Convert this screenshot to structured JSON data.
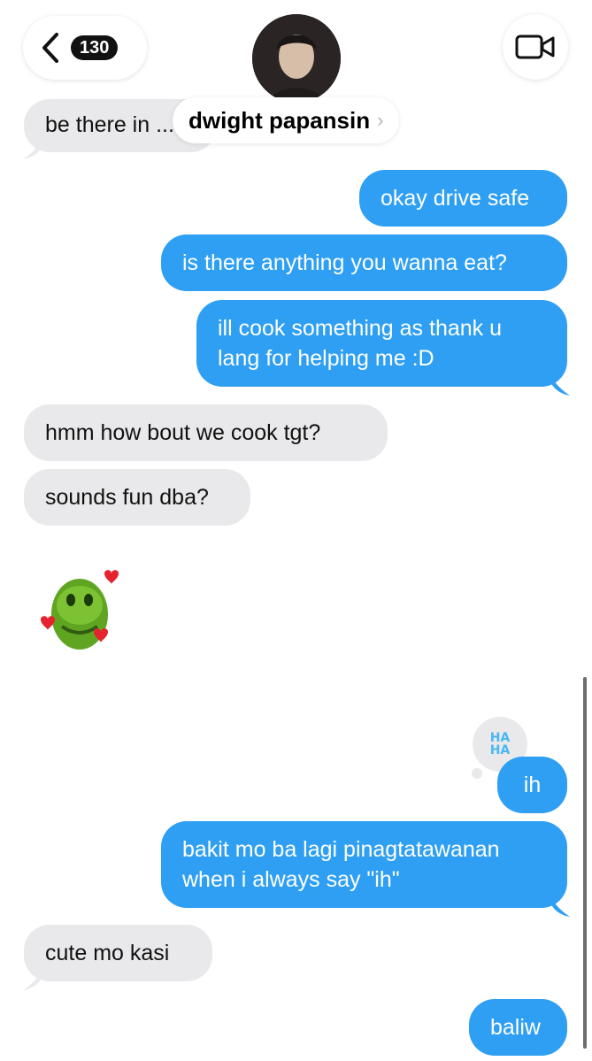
{
  "header": {
    "back_count": "130",
    "contact_name": "dwight papansin",
    "chevron": "›"
  },
  "messages": [
    {
      "id": 0,
      "side": "in",
      "text": "be there in ..."
    },
    {
      "id": 1,
      "side": "out",
      "text": "okay drive safe"
    },
    {
      "id": 2,
      "side": "out",
      "text": "is there anything you wanna eat?"
    },
    {
      "id": 3,
      "side": "out",
      "lines": [
        "ill cook something as thank u",
        "lang for helping me :D"
      ]
    },
    {
      "id": 4,
      "side": "in",
      "text": "hmm how bout we cook tgt?"
    },
    {
      "id": 5,
      "side": "in",
      "text": "sounds fun dba?"
    },
    {
      "id": 6,
      "side": "in",
      "type": "memoji",
      "icon": "dinosaur-memoji-hearts-icon"
    },
    {
      "id": 7,
      "side": "out",
      "text": "ih",
      "tapback": "HA HA"
    },
    {
      "id": 8,
      "side": "out",
      "lines": [
        "bakit mo ba lagi pinagtatawanan",
        "when i always say \"ih\""
      ]
    },
    {
      "id": 9,
      "side": "in",
      "text": "cute mo kasi"
    },
    {
      "id": 10,
      "side": "out",
      "text": "baliw"
    }
  ],
  "colors": {
    "outgoing": "#2e9ff3",
    "incoming": "#e9e9eb"
  }
}
